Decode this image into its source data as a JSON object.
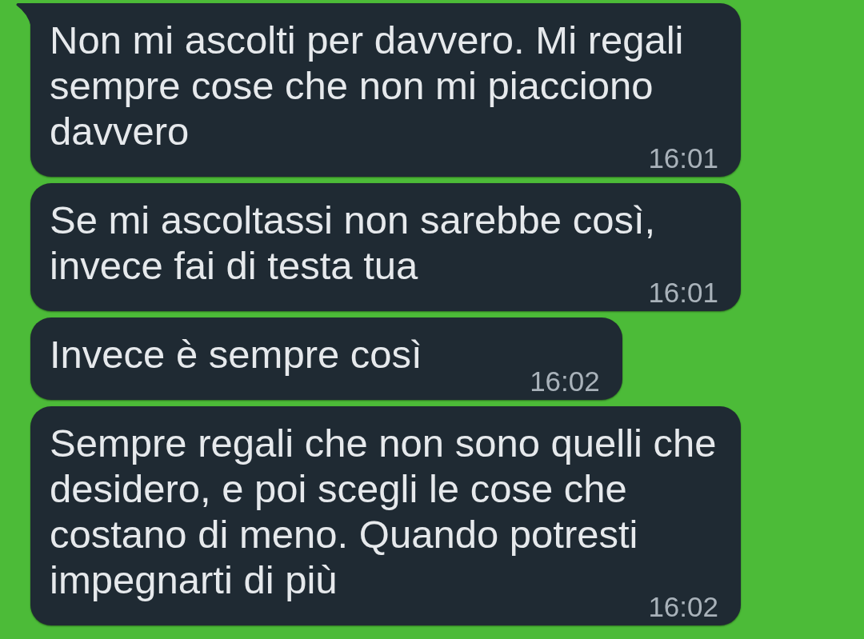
{
  "messages": [
    {
      "text": "Non mi ascolti per davvero. Mi regali sempre cose che non mi piacciono davvero",
      "time": "16:01",
      "tail": true
    },
    {
      "text": "Se mi ascoltassi non sarebbe così, invece fai di testa tua",
      "time": "16:01",
      "tail": false
    },
    {
      "text": "Invece è sempre così",
      "time": "16:02",
      "tail": false
    },
    {
      "text": "Sempre regali che non sono quelli che desidero, e poi scegli le cose che costano di meno. Quando potresti impegnarti di più",
      "time": "16:02",
      "tail": false
    }
  ]
}
